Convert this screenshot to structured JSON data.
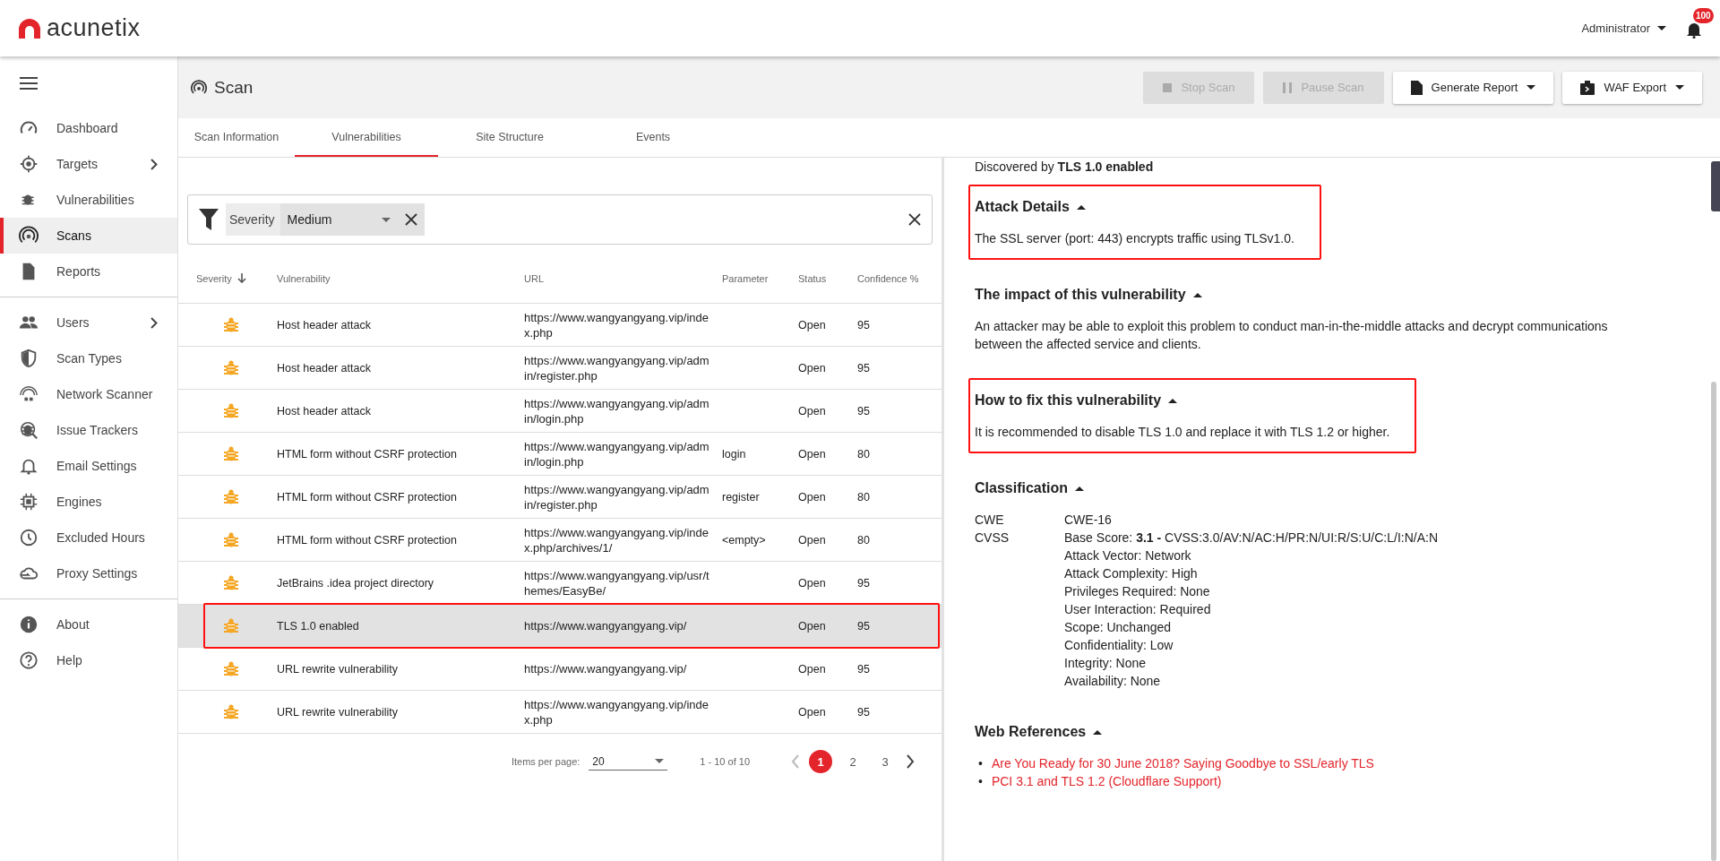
{
  "app": {
    "brand": "acunetix",
    "user": "Administrator",
    "notification_count": "100"
  },
  "sidebar": {
    "groups": [
      [
        {
          "label": "Dashboard",
          "selected": false,
          "has_children": false
        },
        {
          "label": "Targets",
          "selected": false,
          "has_children": true
        },
        {
          "label": "Vulnerabilities",
          "selected": false,
          "has_children": false
        },
        {
          "label": "Scans",
          "selected": true,
          "has_children": false
        },
        {
          "label": "Reports",
          "selected": false,
          "has_children": false
        }
      ],
      [
        {
          "label": "Users",
          "selected": false,
          "has_children": true
        },
        {
          "label": "Scan Types",
          "selected": false,
          "has_children": false
        },
        {
          "label": "Network Scanner",
          "selected": false,
          "has_children": false
        },
        {
          "label": "Issue Trackers",
          "selected": false,
          "has_children": false
        },
        {
          "label": "Email Settings",
          "selected": false,
          "has_children": false
        },
        {
          "label": "Engines",
          "selected": false,
          "has_children": false
        },
        {
          "label": "Excluded Hours",
          "selected": false,
          "has_children": false
        },
        {
          "label": "Proxy Settings",
          "selected": false,
          "has_children": false
        }
      ],
      [
        {
          "label": "About",
          "selected": false,
          "has_children": false
        },
        {
          "label": "Help",
          "selected": false,
          "has_children": false
        }
      ]
    ]
  },
  "page": {
    "title": "Scan",
    "buttons": [
      {
        "label": "Stop Scan",
        "disabled": true,
        "dropdown": false
      },
      {
        "label": "Pause Scan",
        "disabled": true,
        "dropdown": false
      },
      {
        "label": "Generate Report",
        "disabled": false,
        "dropdown": true
      },
      {
        "label": "WAF Export",
        "disabled": false,
        "dropdown": true
      }
    ]
  },
  "tabs": [
    {
      "label": "Scan Information",
      "selected": false
    },
    {
      "label": "Vulnerabilities",
      "selected": true
    },
    {
      "label": "Site Structure",
      "selected": false
    },
    {
      "label": "Events",
      "selected": false
    }
  ],
  "filter": {
    "label": "Severity",
    "value": "Medium"
  },
  "table": {
    "columns": [
      {
        "label": "Severity",
        "sorted": true
      },
      {
        "label": "Vulnerability",
        "sorted": false
      },
      {
        "label": "URL",
        "sorted": false
      },
      {
        "label": "Parameter",
        "sorted": false
      },
      {
        "label": "Status",
        "sorted": false
      },
      {
        "label": "Confidence %",
        "sorted": false
      }
    ],
    "rows": [
      {
        "vulnerability": "Host header attack",
        "url": "https://www.wangyangyang.vip/index.php",
        "parameter": "",
        "status": "Open",
        "confidence": "95",
        "selected": false,
        "highlighted": false
      },
      {
        "vulnerability": "Host header attack",
        "url": "https://www.wangyangyang.vip/admin/register.php",
        "parameter": "",
        "status": "Open",
        "confidence": "95",
        "selected": false,
        "highlighted": false
      },
      {
        "vulnerability": "Host header attack",
        "url": "https://www.wangyangyang.vip/admin/login.php",
        "parameter": "",
        "status": "Open",
        "confidence": "95",
        "selected": false,
        "highlighted": false
      },
      {
        "vulnerability": "HTML form without CSRF protection",
        "url": "https://www.wangyangyang.vip/admin/login.php",
        "parameter": "login",
        "status": "Open",
        "confidence": "80",
        "selected": false,
        "highlighted": false
      },
      {
        "vulnerability": "HTML form without CSRF protection",
        "url": "https://www.wangyangyang.vip/admin/register.php",
        "parameter": "register",
        "status": "Open",
        "confidence": "80",
        "selected": false,
        "highlighted": false
      },
      {
        "vulnerability": "HTML form without CSRF protection",
        "url": "https://www.wangyangyang.vip/index.php/archives/1/",
        "parameter": "<empty>",
        "status": "Open",
        "confidence": "80",
        "selected": false,
        "highlighted": false
      },
      {
        "vulnerability": "JetBrains .idea project directory",
        "url": "https://www.wangyangyang.vip/usr/themes/EasyBe/",
        "parameter": "",
        "status": "Open",
        "confidence": "95",
        "selected": false,
        "highlighted": false
      },
      {
        "vulnerability": "TLS 1.0 enabled",
        "url": "https://www.wangyangyang.vip/",
        "parameter": "",
        "status": "Open",
        "confidence": "95",
        "selected": true,
        "highlighted": true
      },
      {
        "vulnerability": "URL rewrite vulnerability",
        "url": "https://www.wangyangyang.vip/",
        "parameter": "",
        "status": "Open",
        "confidence": "95",
        "selected": false,
        "highlighted": false
      },
      {
        "vulnerability": "URL rewrite vulnerability",
        "url": "https://www.wangyangyang.vip/index.php",
        "parameter": "",
        "status": "Open",
        "confidence": "95",
        "selected": false,
        "highlighted": false
      }
    ]
  },
  "pagination": {
    "items_per_page_label": "Items per page:",
    "items_per_page": "20",
    "range": "1 - 10 of 10",
    "pages": [
      {
        "label": "1",
        "selected": true
      },
      {
        "label": "2",
        "selected": false
      },
      {
        "label": "3",
        "selected": false
      }
    ]
  },
  "details": {
    "discovered_by": "Discovered by **TLS 1.0 enabled**",
    "sections": [
      {
        "kind": "text",
        "title": "Attack Details",
        "expanded": true,
        "highlighted": true,
        "text": "The SSL server (port: 443) encrypts traffic using TLSv1.0."
      },
      {
        "kind": "text",
        "title": "The impact of this vulnerability",
        "expanded": true,
        "highlighted": false,
        "text": "An attacker may be able to exploit this problem to conduct man-in-the-middle attacks and decrypt communications between the affected service and clients."
      },
      {
        "kind": "text",
        "title": "How to fix this vulnerability",
        "expanded": true,
        "highlighted": true,
        "text": "It is recommended to disable TLS 1.0 and replace it with TLS 1.2 or higher."
      },
      {
        "kind": "classification",
        "title": "Classification",
        "expanded": true,
        "highlighted": false,
        "rows": [
          {
            "label": "CWE",
            "lines": [
              "CWE-16"
            ]
          },
          {
            "label": "CVSS",
            "lines": [
              "Base Score: **3.1 -** CVSS:3.0/AV:N/AC:H/PR:N/UI:R/S:U/C:L/I:N/A:N",
              "Attack Vector: Network",
              "Attack Complexity: High",
              "Privileges Required: None",
              "User Interaction: Required",
              "Scope: Unchanged",
              "Confidentiality: Low",
              "Integrity: None",
              "Availability: None"
            ]
          }
        ]
      },
      {
        "kind": "references",
        "title": "Web References",
        "expanded": true,
        "highlighted": false,
        "links": [
          {
            "bullet": "•",
            "label": "Are You Ready for 30 June 2018? Saying Goodbye to SSL/early TLS"
          },
          {
            "bullet": "•",
            "label": "PCI 3.1 and TLS 1.2 (Cloudflare Support)"
          }
        ]
      }
    ]
  }
}
